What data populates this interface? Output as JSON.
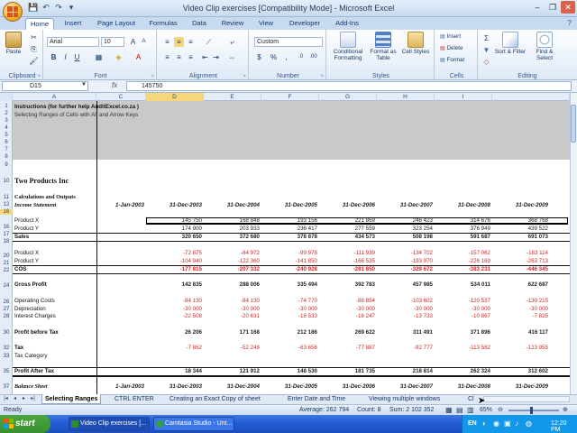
{
  "window": {
    "title": "Video Clip exercises  [Compatibility Mode]  -  Microsoft Excel",
    "min_label": "–",
    "max_label": "❐",
    "close_label": "✕"
  },
  "ribbon_tabs": [
    "Home",
    "Insert",
    "Page Layout",
    "Formulas",
    "Data",
    "Review",
    "View",
    "Developer",
    "Add-Ins"
  ],
  "ribbon": {
    "clipboard": {
      "label": "Clipboard",
      "paste": "Paste"
    },
    "font": {
      "label": "Font",
      "name": "Arial",
      "size": "10"
    },
    "alignment": {
      "label": "Alignment"
    },
    "number": {
      "label": "Number",
      "format": "Custom"
    },
    "styles": {
      "label": "Styles",
      "conditional": "Conditional Formatting",
      "format_table": "Format as Table",
      "cell_styles": "Cell Styles"
    },
    "cells": {
      "label": "Cells",
      "insert": "Insert",
      "delete": "Delete",
      "format": "Format"
    },
    "editing": {
      "label": "Editing",
      "sort": "Sort & Filter",
      "find": "Find & Select"
    }
  },
  "formula_bar": {
    "name_box": "D15",
    "formula": "145750",
    "fx": "fx"
  },
  "columns": [
    "A",
    "B",
    "C",
    "D",
    "E",
    "F",
    "G",
    "H",
    "I"
  ],
  "row_numbers": [
    "1",
    "2",
    "3",
    "4",
    "5",
    "6",
    "7",
    "8",
    "9",
    "10",
    "11",
    "12",
    "13",
    "16",
    "16",
    "17",
    "18",
    "20",
    "21",
    "22",
    "23",
    "24",
    "25",
    "26",
    "27",
    "28",
    "29",
    "30",
    "31",
    "32",
    "33",
    "34",
    "35",
    "36",
    "37"
  ],
  "sheet": {
    "instructions": "Instructions (for further help AuditExcel.co.za )",
    "instructions_sub": "Selecting Ranges of Cells with Alt and Arrow Keys",
    "company": "Two Products Inc",
    "calc_header": "Calculations and Outputs",
    "income_stmt": "Income Statement",
    "dates": [
      "1-Jan-2003",
      "31-Dec-2003",
      "31-Dec-2004",
      "31-Dec-2005",
      "31-Dec-2006",
      "31-Dec-2007",
      "31-Dec-2008",
      "31-Dec-2009"
    ],
    "rows": [
      {
        "label": "Product X",
        "values": [
          "145 750",
          "168 848",
          "193 156",
          "221 869",
          "246 423",
          "314 676",
          "368 768"
        ]
      },
      {
        "label": "Product Y",
        "values": [
          "174 900",
          "203 933",
          "236 417",
          "277 559",
          "323 254",
          "376 949",
          "439 522"
        ]
      },
      {
        "label": "Sales",
        "values": [
          "320 650",
          "372 680",
          "378 878",
          "434 573",
          "508 198",
          "591 687",
          "691 073"
        ]
      },
      {
        "label": "Product X",
        "values": [
          "-72 875",
          "-84 972",
          "-99 978",
          "-111 939",
          "-134 702",
          "-157 062",
          "-183 114"
        ]
      },
      {
        "label": "Product Y",
        "values": [
          "-104 940",
          "-122 360",
          "-141 850",
          "-166 535",
          "-193 970",
          "-226 169",
          "-263 713"
        ]
      },
      {
        "label": "COS",
        "values": [
          "-177 815",
          "-207 332",
          "-240 928",
          "-281 850",
          "-329 672",
          "-383 231",
          "-446 345"
        ]
      },
      {
        "label": "Gross Profit",
        "values": [
          "142 835",
          "288 006",
          "335 494",
          "392 783",
          "457 985",
          "534 011",
          "622 687"
        ]
      },
      {
        "label": "Operating Costs",
        "values": [
          "-84 130",
          "-84 130",
          "-74 770",
          "-88 854",
          "-103 602",
          "-120 537",
          "-130 215"
        ]
      },
      {
        "label": "Depreciation",
        "values": [
          "-30 000",
          "-30 000",
          "-30 000",
          "-30 000",
          "-30 000",
          "-30 000",
          "-30 000"
        ]
      },
      {
        "label": "Interest Charges",
        "values": [
          "-22 508",
          "-20 631",
          "-18 533",
          "-16 247",
          "-13 733",
          "-10 867",
          "-7 825"
        ]
      },
      {
        "label": "Profit before Tax",
        "values": [
          "26 206",
          "171 168",
          "212 186",
          "269 622",
          "311 491",
          "371 896",
          "416 117"
        ]
      },
      {
        "label": "Tax",
        "values": [
          "-7 862",
          "-52 248",
          "-63 656",
          "-77 887",
          "-92 777",
          "-113 582",
          "-123 955"
        ]
      },
      {
        "label": "Tax Category",
        "values": [
          "",
          "",
          "",
          "",
          "",
          "",
          ""
        ]
      },
      {
        "label": "Profit After Tax",
        "values": [
          "18 344",
          "121 912",
          "148 530",
          "181 735",
          "218 814",
          "262 324",
          "312 602"
        ]
      },
      {
        "label": "Balance Sheet",
        "values": [
          "",
          "",
          "",
          "",
          "",
          "",
          ""
        ]
      }
    ]
  },
  "sheet_tabs": [
    "Selecting Ranges",
    "CTRL ENTER",
    "Creating an Exact Copy of sheet",
    "Enter Date and Time",
    "Viewing multiple windows",
    "Cl"
  ],
  "status": {
    "mode": "Ready",
    "average": "Average: 262 794",
    "count": "Count: 8",
    "sum": "Sum: 2 102 352",
    "zoom": "65%"
  },
  "taskbar": {
    "start": "start",
    "tasks": [
      "Video Clip exercises [...",
      "Camtasia Studio - Unt..."
    ],
    "lang": "EN",
    "clock": "12:20 PM"
  },
  "colors": {
    "accent": "#c8daf0",
    "negative": "#dd2222",
    "taskbar": "#245ed6"
  }
}
